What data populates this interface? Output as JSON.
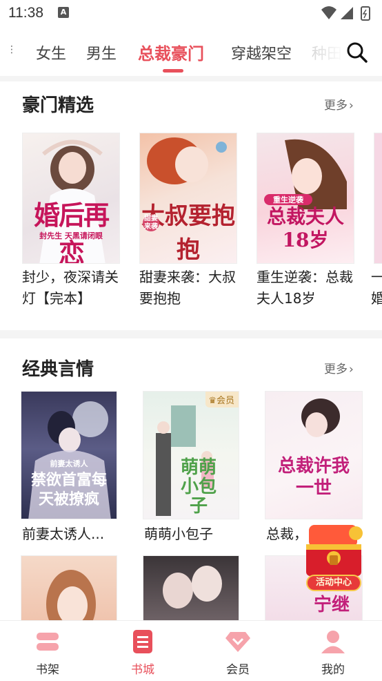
{
  "status_bar": {
    "time": "11:38",
    "notification_icon": "A"
  },
  "tabs": {
    "items": [
      {
        "label": "女生"
      },
      {
        "label": "男生"
      },
      {
        "label": "总裁豪门"
      },
      {
        "label": "穿越架空"
      },
      {
        "label": "种田"
      }
    ],
    "active_index": 2
  },
  "colors": {
    "accent": "#e8505b"
  },
  "section1": {
    "title": "豪门精选",
    "more": "更多",
    "books": [
      {
        "name": "封少，夜深请关灯【完本】",
        "cover_text": "婚后再恋",
        "cover_sub": "封先生 天黑请闭眼"
      },
      {
        "name": "甜妻来袭：大叔要抱抱",
        "cover_text": "大叔要抱抱",
        "cover_sub": "甜妻来袭"
      },
      {
        "name": "重生逆袭：总裁夫人18岁",
        "cover_text": "总裁夫人18岁",
        "cover_sub": "重生逆袭"
      },
      {
        "name": "一婚"
      }
    ]
  },
  "section2": {
    "title": "经典言情",
    "more": "更多",
    "books": [
      {
        "name": "前妻太诱人...",
        "cover_text": "禁欲首富每天被撩疯",
        "cover_sub": "前妻太诱人"
      },
      {
        "name": "萌萌小包子",
        "cover_text": "萌萌小包子",
        "badge": "会员"
      },
      {
        "name": "总裁，",
        "cover_text": "总裁许我一世"
      }
    ],
    "row2_covers": [
      {
        "cover_text": ""
      },
      {
        "cover_text": ""
      },
      {
        "cover_text": "宁继"
      }
    ]
  },
  "activity": {
    "label": "活动中心"
  },
  "bottom_nav": {
    "items": [
      {
        "label": "书架",
        "icon": "bookshelf-icon"
      },
      {
        "label": "书城",
        "icon": "bookstore-icon"
      },
      {
        "label": "会员",
        "icon": "diamond-icon"
      },
      {
        "label": "我的",
        "icon": "profile-icon"
      }
    ],
    "active_index": 1
  }
}
